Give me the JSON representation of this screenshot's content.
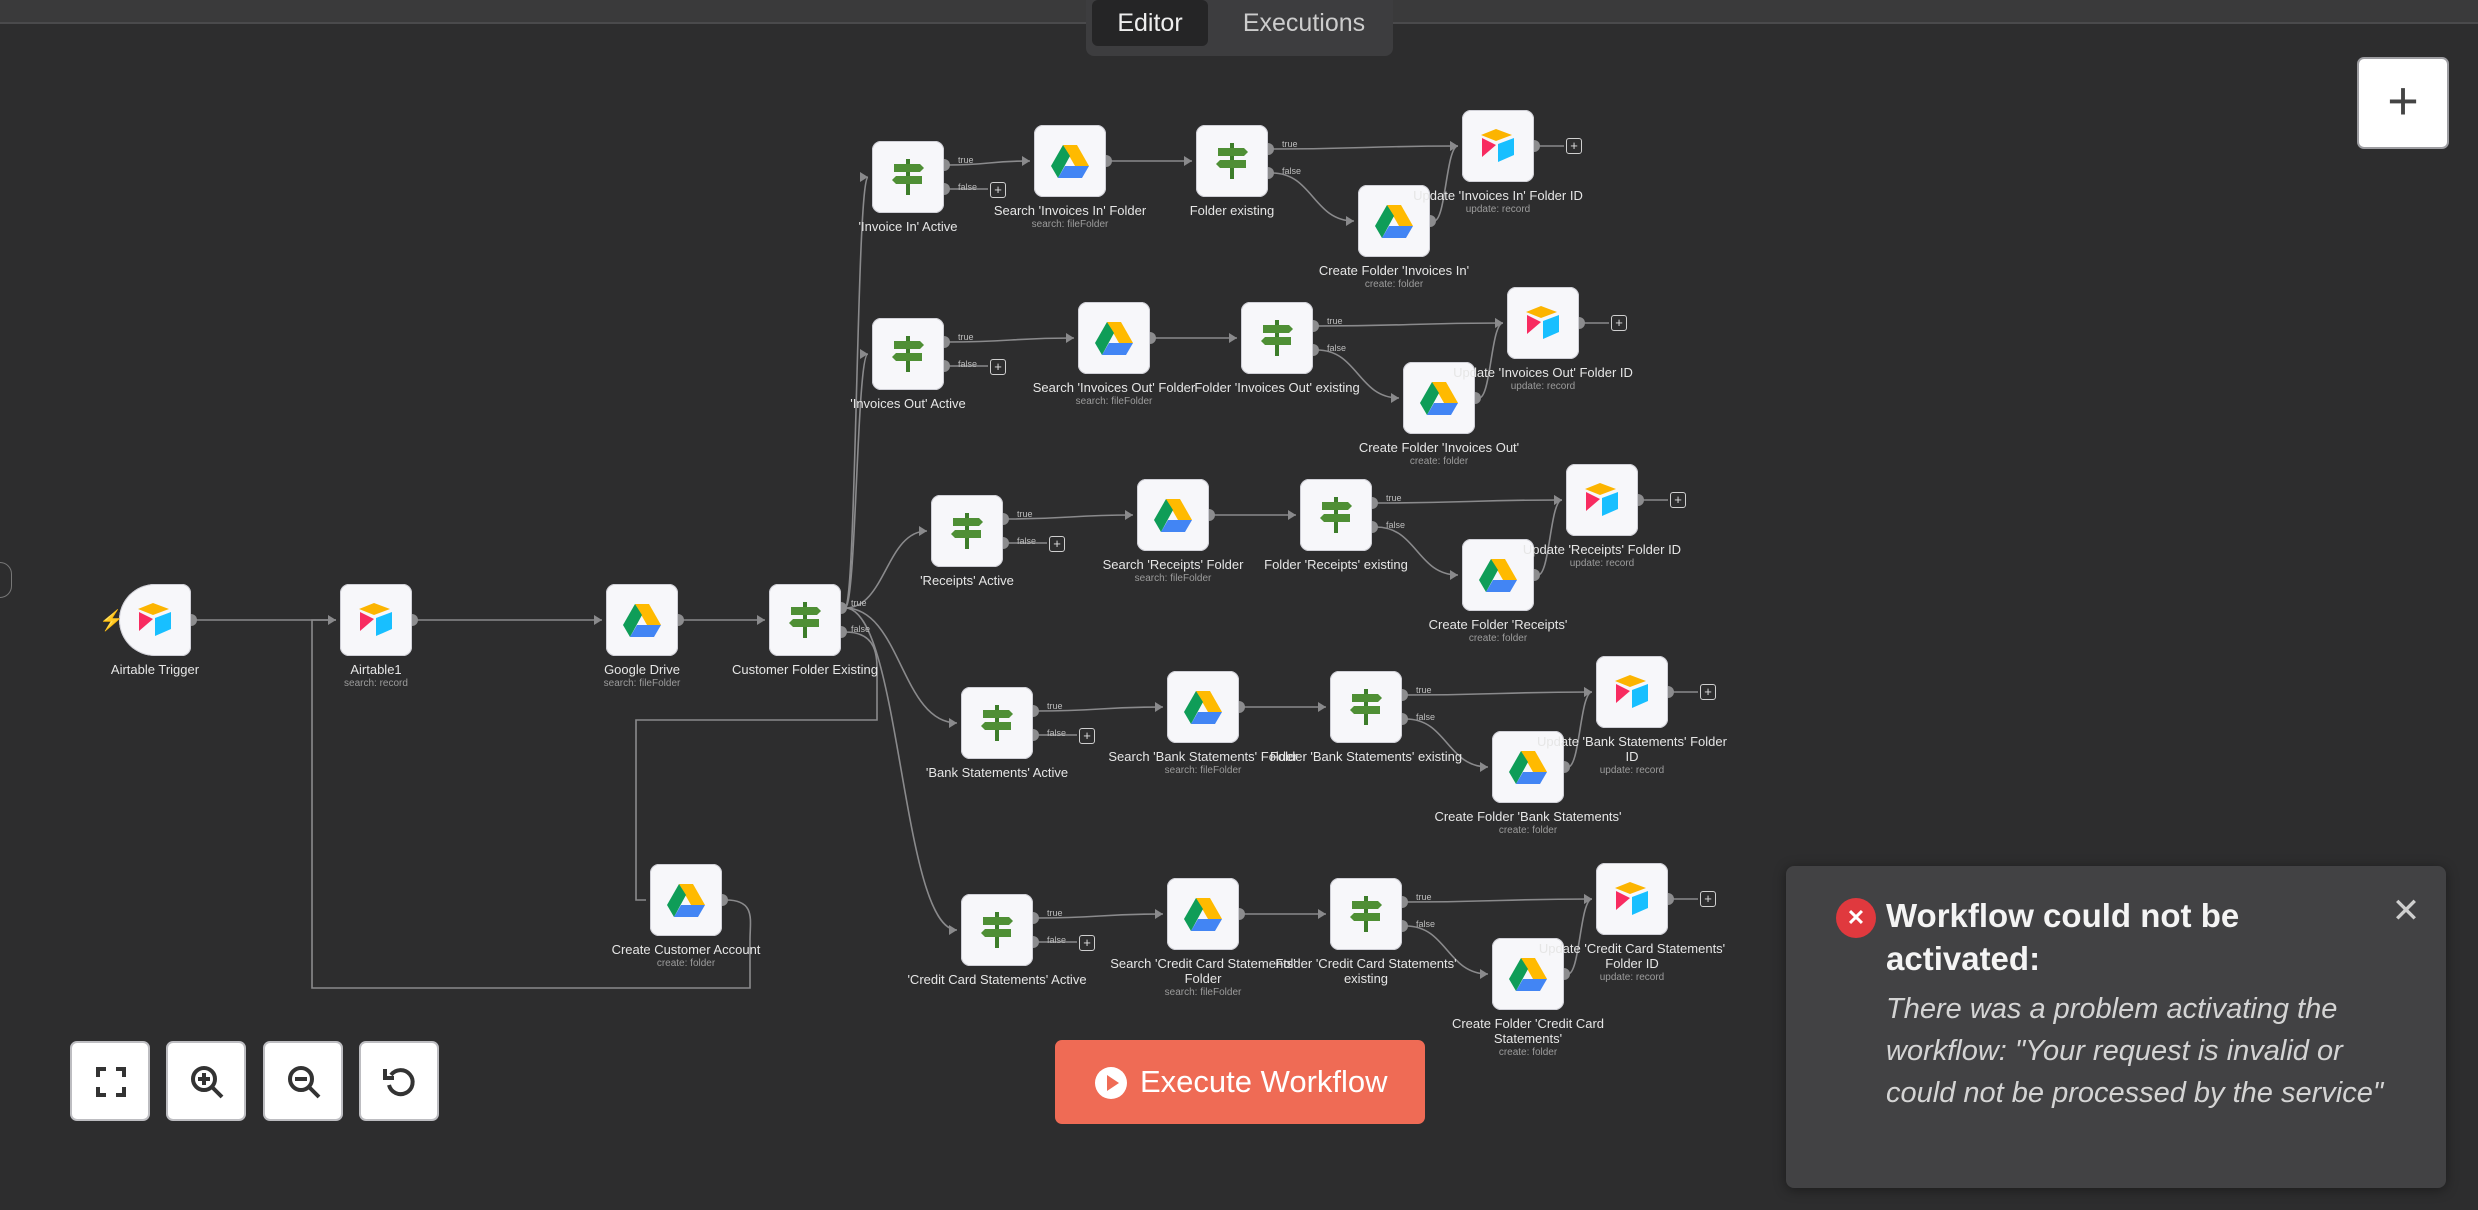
{
  "header": {
    "tabs": [
      {
        "label": "Editor",
        "active": true
      },
      {
        "label": "Executions",
        "active": false
      }
    ]
  },
  "canvas": {
    "add_node_label": "+",
    "nodes": [
      {
        "id": "airtable-trigger",
        "label": "Airtable Trigger",
        "sub": "",
        "icon": "airtable-icon",
        "is_trigger": true
      },
      {
        "id": "airtable1",
        "label": "Airtable1",
        "sub": "search: record",
        "icon": "airtable-icon"
      },
      {
        "id": "google-drive",
        "label": "Google Drive",
        "sub": "search: fileFolder",
        "icon": "google-drive-icon"
      },
      {
        "id": "customer-folder-existing",
        "label": "Customer Folder Existing",
        "sub": "",
        "icon": "if-icon"
      },
      {
        "id": "create-customer-account",
        "label": "Create Customer Account",
        "sub": "create: folder",
        "icon": "google-drive-icon"
      },
      {
        "id": "invoice-in-active",
        "label": "'Invoice In' Active",
        "sub": "",
        "icon": "if-icon"
      },
      {
        "id": "search-invoices-in-folder",
        "label": "Search 'Invoices In' Folder",
        "sub": "search: fileFolder",
        "icon": "google-drive-icon"
      },
      {
        "id": "folder-existing",
        "label": "Folder existing",
        "sub": "",
        "icon": "if-icon"
      },
      {
        "id": "create-folder-invoices-in",
        "label": "Create Folder 'Invoices In'",
        "sub": "create: folder",
        "icon": "google-drive-icon"
      },
      {
        "id": "update-invoices-in-folder-id",
        "label": "Update 'Invoices In' Folder ID",
        "sub": "update: record",
        "icon": "airtable-icon"
      },
      {
        "id": "invoices-out-active",
        "label": "'Invoices Out' Active",
        "sub": "",
        "icon": "if-icon"
      },
      {
        "id": "search-invoices-out-folder",
        "label": "Search 'Invoices Out' Folder",
        "sub": "search: fileFolder",
        "icon": "google-drive-icon"
      },
      {
        "id": "folder-invoices-out-existing",
        "label": "Folder 'Invoices Out' existing",
        "sub": "",
        "icon": "if-icon"
      },
      {
        "id": "create-folder-invoices-out",
        "label": "Create Folder 'Invoices Out'",
        "sub": "create: folder",
        "icon": "google-drive-icon"
      },
      {
        "id": "update-invoices-out-folder-id",
        "label": "Update 'Invoices Out' Folder ID",
        "sub": "update: record",
        "icon": "airtable-icon"
      },
      {
        "id": "receipts-active",
        "label": "'Receipts' Active",
        "sub": "",
        "icon": "if-icon"
      },
      {
        "id": "search-receipts-folder",
        "label": "Search 'Receipts' Folder",
        "sub": "search: fileFolder",
        "icon": "google-drive-icon"
      },
      {
        "id": "folder-receipts-existing",
        "label": "Folder 'Receipts' existing",
        "sub": "",
        "icon": "if-icon"
      },
      {
        "id": "create-folder-receipts",
        "label": "Create Folder 'Receipts'",
        "sub": "create: folder",
        "icon": "google-drive-icon"
      },
      {
        "id": "update-receipts-folder-id",
        "label": "Update 'Receipts' Folder ID",
        "sub": "update: record",
        "icon": "airtable-icon"
      },
      {
        "id": "bank-statements-active",
        "label": "'Bank Statements' Active",
        "sub": "",
        "icon": "if-icon"
      },
      {
        "id": "search-bank-statements-folder",
        "label": "Search 'Bank Statements' Folder",
        "sub": "search: fileFolder",
        "icon": "google-drive-icon"
      },
      {
        "id": "folder-bank-statements-existing",
        "label": "Folder 'Bank Statements' existing",
        "sub": "",
        "icon": "if-icon"
      },
      {
        "id": "create-folder-bank-statements",
        "label": "Create Folder 'Bank Statements'",
        "sub": "create: folder",
        "icon": "google-drive-icon"
      },
      {
        "id": "update-bank-statements-folder-id",
        "label": "Update 'Bank Statements' Folder ID",
        "sub": "update: record",
        "icon": "airtable-icon"
      },
      {
        "id": "credit-card-statements-active",
        "label": "'Credit Card Statements' Active",
        "sub": "",
        "icon": "if-icon"
      },
      {
        "id": "search-credit-card-statements-folder",
        "label": "Search 'Credit Card Statements' Folder",
        "sub": "search: fileFolder",
        "icon": "google-drive-icon"
      },
      {
        "id": "folder-credit-card-statements-existing",
        "label": "Folder 'Credit Card Statements' existing",
        "sub": "",
        "icon": "if-icon"
      },
      {
        "id": "create-folder-credit-card-statements",
        "label": "Create Folder 'Credit Card Statements'",
        "sub": "create: folder",
        "icon": "google-drive-icon"
      },
      {
        "id": "update-credit-card-statements-folder-id",
        "label": "Update 'Credit Card Statements' Folder ID",
        "sub": "update: record",
        "icon": "airtable-icon"
      }
    ],
    "branch_labels": {
      "true": "true",
      "false": "false"
    }
  },
  "controls": {
    "zoom_to_fit": "zoom-to-fit-icon",
    "zoom_in": "zoom-in-icon",
    "zoom_out": "zoom-out-icon",
    "reset_zoom": "reset-zoom-icon"
  },
  "execute_button": {
    "label": "Execute Workflow"
  },
  "toast": {
    "title": "Workflow could not be activated:",
    "message": "There was a problem activating the workflow: \"Your request is invalid or could not be processed by the service\""
  },
  "colors": {
    "accent": "#ef6b55",
    "error": "#e0393e",
    "canvas": "#2d2d2e"
  }
}
